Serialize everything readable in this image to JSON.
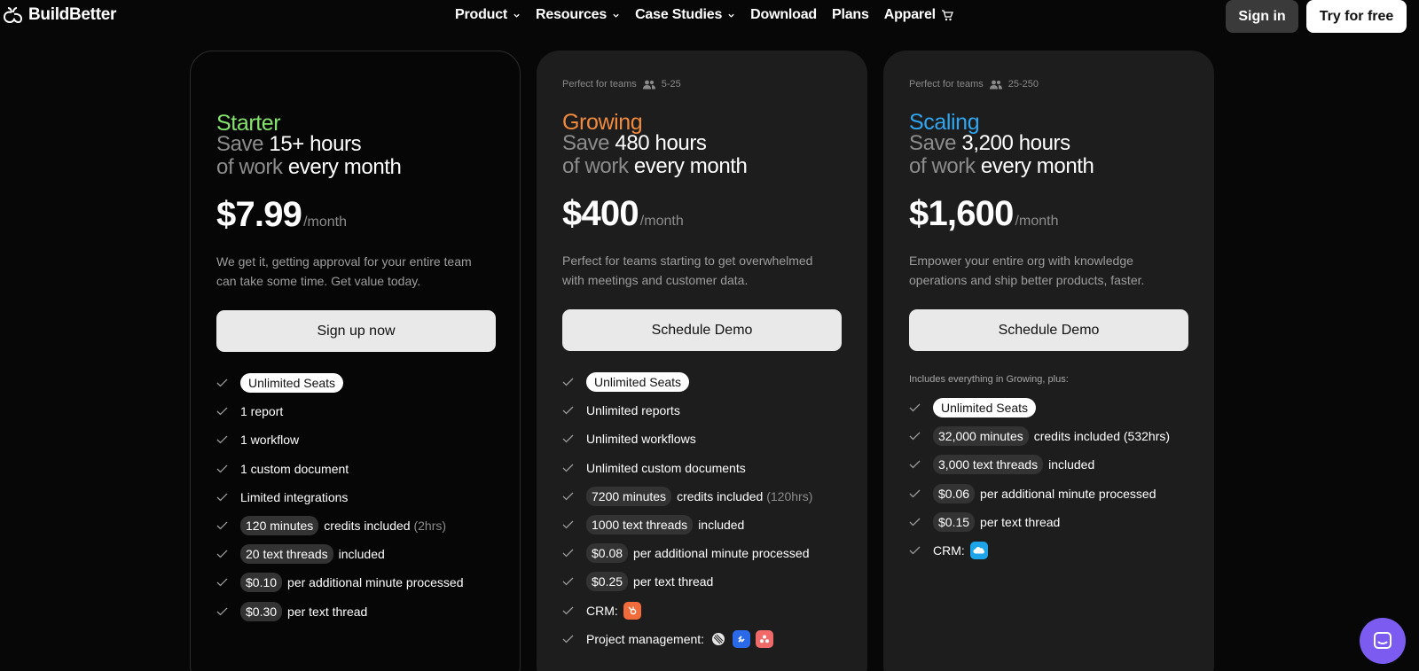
{
  "nav": {
    "brand": "BuildBetter",
    "links": [
      {
        "label": "Product",
        "dropdown": true
      },
      {
        "label": "Resources",
        "dropdown": true
      },
      {
        "label": "Case Studies",
        "dropdown": true
      },
      {
        "label": "Download",
        "dropdown": false
      },
      {
        "label": "Plans",
        "dropdown": false
      },
      {
        "label": "Apparel",
        "cart": true
      }
    ],
    "signin": "Sign in",
    "try": "Try for free"
  },
  "plans": [
    {
      "perfect_for": "",
      "team_size": "",
      "name": "Starter",
      "name_color": "#84e36a",
      "save_prefix": "Save",
      "save_amount": "15+ hours",
      "save_mid": "of work",
      "save_suffix": "every month",
      "price": "$7.99",
      "per": "/month",
      "description": "We get it, getting approval for your entire team can take some time. Get value today.",
      "cta": "Sign up now",
      "includes": "",
      "features": [
        {
          "pill": "Unlimited Seats",
          "pill_style": "white",
          "text": "",
          "muted": ""
        },
        {
          "pill": "",
          "text": "1 report",
          "muted": ""
        },
        {
          "pill": "",
          "text": "1 workflow",
          "muted": ""
        },
        {
          "pill": "",
          "text": "1 custom document",
          "muted": ""
        },
        {
          "pill": "",
          "text": "Limited integrations",
          "muted": ""
        },
        {
          "pill": "120 minutes",
          "text": "credits included",
          "muted": "(2hrs)"
        },
        {
          "pill": "20 text threads",
          "text": "included",
          "muted": ""
        },
        {
          "pill": "$0.10",
          "text": "per additional minute processed",
          "muted": ""
        },
        {
          "pill": "$0.30",
          "text": "per text thread",
          "muted": ""
        }
      ]
    },
    {
      "perfect_for": "Perfect for teams",
      "team_size": "5-25",
      "name": "Growing",
      "name_color": "#f08a3c",
      "save_prefix": "Save",
      "save_amount": "480 hours",
      "save_mid": "of work",
      "save_suffix": "every month",
      "price": "$400",
      "per": "/month",
      "description": "Perfect for teams starting to get overwhelmed with meetings and customer data.",
      "cta": "Schedule Demo",
      "includes": "",
      "features": [
        {
          "pill": "Unlimited Seats",
          "pill_style": "white",
          "text": "",
          "muted": ""
        },
        {
          "pill": "",
          "text": "Unlimited reports",
          "muted": ""
        },
        {
          "pill": "",
          "text": "Unlimited workflows",
          "muted": ""
        },
        {
          "pill": "",
          "text": "Unlimited custom documents",
          "muted": ""
        },
        {
          "pill": "7200 minutes",
          "text": "credits included",
          "muted": "(120hrs)"
        },
        {
          "pill": "1000 text threads",
          "text": "included",
          "muted": ""
        },
        {
          "pill": "$0.08",
          "text": "per additional minute processed",
          "muted": ""
        },
        {
          "pill": "$0.25",
          "text": "per text thread",
          "muted": ""
        },
        {
          "pill": "",
          "text": "CRM:",
          "muted": "",
          "icons": [
            "hubspot-icon"
          ]
        },
        {
          "pill": "",
          "text": "Project management:",
          "muted": "",
          "icons": [
            "linear-icon",
            "jira-icon",
            "asana-icon"
          ]
        }
      ]
    },
    {
      "perfect_for": "Perfect for teams",
      "team_size": "25-250",
      "name": "Scaling",
      "name_color": "#2fa6f0",
      "save_prefix": "Save",
      "save_amount": "3,200 hours",
      "save_mid": "of work",
      "save_suffix": "every month",
      "price": "$1,600",
      "per": "/month",
      "description": "Empower your entire org with knowledge operations and ship better products, faster.",
      "cta": "Schedule Demo",
      "includes": "Includes everything in Growing, plus:",
      "features": [
        {
          "pill": "Unlimited Seats",
          "pill_style": "white",
          "text": "",
          "muted": ""
        },
        {
          "pill": "32,000 minutes",
          "text": "credits included (532hrs)",
          "muted": ""
        },
        {
          "pill": "3,000 text threads",
          "text": "included",
          "muted": ""
        },
        {
          "pill": "$0.06",
          "text": "per additional minute  processed",
          "muted": ""
        },
        {
          "pill": "$0.15",
          "text": "per text thread",
          "muted": ""
        },
        {
          "pill": "",
          "text": "CRM:",
          "muted": "",
          "icons": [
            "salesforce-icon"
          ]
        }
      ]
    }
  ]
}
